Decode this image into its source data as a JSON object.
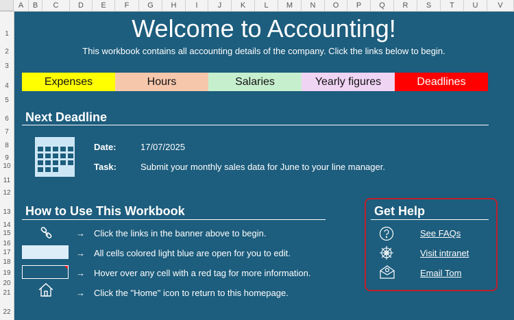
{
  "sheet": {
    "columns": [
      "A",
      "B",
      "C",
      "D",
      "E",
      "F",
      "G",
      "H",
      "I",
      "J",
      "K",
      "L",
      "M",
      "N",
      "O",
      "P",
      "Q",
      "R",
      "S",
      "T",
      "U",
      "V"
    ],
    "rows": [
      "1",
      "2",
      "3",
      "4",
      "5",
      "6",
      "7",
      "8",
      "9",
      "10",
      "11",
      "12",
      "13",
      "14",
      "15",
      "16",
      "17",
      "18",
      "19",
      "20",
      "21",
      "22"
    ]
  },
  "header": {
    "title": "Welcome to Accounting!",
    "subtitle": "This workbook contains all accounting details of the company. Click the links below to begin."
  },
  "banner": [
    {
      "label": "Expenses",
      "color": "#ffff00"
    },
    {
      "label": "Hours",
      "color": "#f7c7ac"
    },
    {
      "label": "Salaries",
      "color": "#c6efce"
    },
    {
      "label": "Yearly figures",
      "color": "#f0d4f4"
    },
    {
      "label": "Deadlines",
      "color": "#ff0000"
    }
  ],
  "deadline": {
    "heading": "Next Deadline",
    "date_label": "Date:",
    "date_value": "17/07/2025",
    "task_label": "Task:",
    "task_value": "Submit your monthly sales data for June to your line manager.",
    "icon": "calendar-icon"
  },
  "how_to": {
    "heading": "How to Use This Workbook",
    "arrow": "→",
    "items": [
      {
        "icon": "link-icon",
        "text": "Click the links in the banner above to begin."
      },
      {
        "icon": "light-blue-cell-swatch",
        "text": "All cells colored light blue are open for you to edit."
      },
      {
        "icon": "red-tag-cell-swatch",
        "text": "Hover over any cell with a red tag for more information."
      },
      {
        "icon": "home-icon",
        "text": "Click the \"Home\" icon to return to this homepage."
      }
    ]
  },
  "help": {
    "heading": "Get Help",
    "links": [
      {
        "icon": "question-icon",
        "label": "See FAQs"
      },
      {
        "icon": "web-icon",
        "label": "Visit intranet"
      },
      {
        "icon": "email-icon",
        "label": "Email Tom"
      }
    ],
    "border_color": "#c0202a"
  },
  "colors": {
    "background": "#1d5d7d",
    "light_blue_cell": "#ddeef8"
  }
}
